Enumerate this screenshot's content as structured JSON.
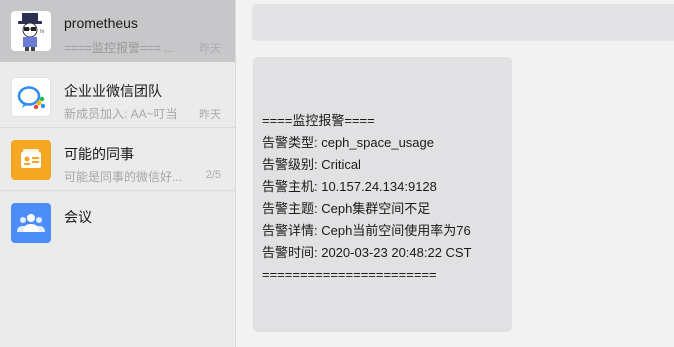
{
  "conversations": [
    {
      "title": "prometheus",
      "preview": "====监控报警=== ...",
      "time": "昨天",
      "avatar_icon": "cartoon-person-avatar",
      "active": true
    },
    {
      "title": "企业业微信团队",
      "preview": "新成员加入: AA~叮当",
      "time": "昨天",
      "avatar_icon": "wecom-logo-icon",
      "active": false
    },
    {
      "title": "可能的同事",
      "preview": "可能是同事的微信好...",
      "time": "2/5",
      "avatar_icon": "contact-card-icon",
      "avatar_color": "#f5a623",
      "active": false
    },
    {
      "title": "会议",
      "preview": "",
      "time": "",
      "avatar_icon": "meeting-people-icon",
      "avatar_color": "#4d8df7",
      "active": false
    }
  ],
  "message": {
    "lines": [
      "====监控报警====",
      "告警类型: ceph_space_usage",
      "告警级别: Critical",
      "告警主机: 10.157.24.134:9128",
      "告警主题: Ceph集群空间不足",
      "告警详情: Ceph当前空间使用率为76",
      "告警时间: 2020-03-23 20:48:22 CST",
      "======================="
    ]
  },
  "colors": {
    "sidebar_bg": "#ebebec",
    "active_item_bg": "#c7c7c9",
    "chat_bg": "#f2f2f3",
    "bubble_bg": "#e1e1e3"
  }
}
